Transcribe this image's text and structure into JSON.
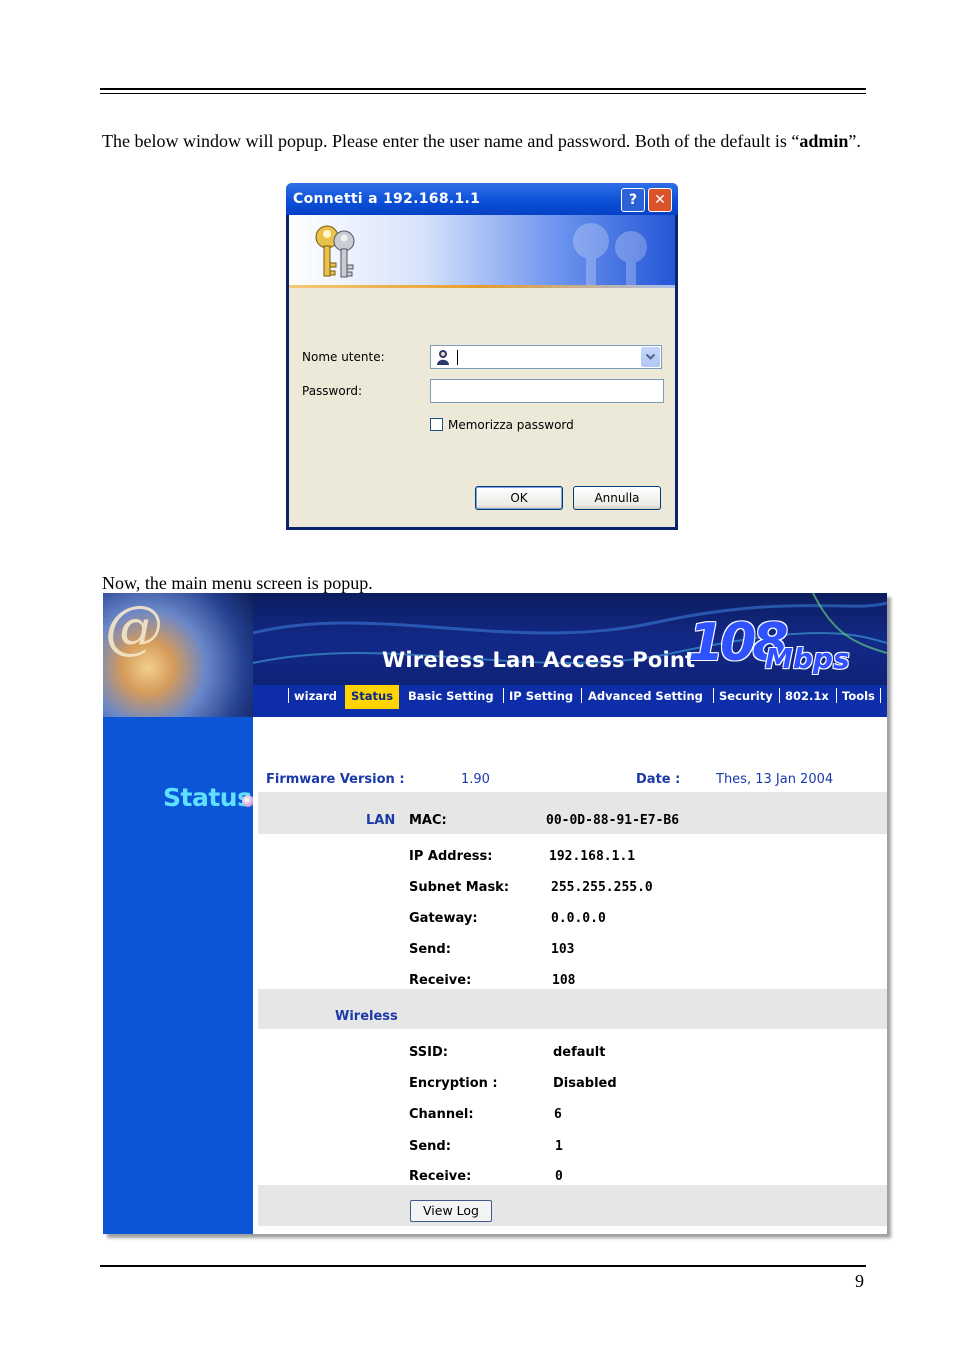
{
  "page": {
    "intro_part1": "The below window will popup.  Please enter the user name and password.  Both of the default is “",
    "intro_bold": "admin",
    "intro_part2": "”.",
    "now_text": "Now, the main menu screen is popup.",
    "page_number": "9"
  },
  "dialog": {
    "title": "Connetti a 192.168.1.1",
    "help_button": "?",
    "close_button": "✕",
    "username_label": "Nome utente:",
    "password_label": "Password:",
    "username_value": "",
    "password_value": "",
    "remember_label": "Memorizza password",
    "remember_checked": false,
    "ok_label": "OK",
    "cancel_label": "Annulla"
  },
  "router": {
    "header_title": "Wireless Lan Access Point",
    "speed_number": "108",
    "speed_unit": "Mbps",
    "nav": {
      "wizard": "wizard",
      "status": "Status",
      "basic": "Basic  Setting",
      "ip": "IP Setting",
      "advanced": "Advanced Setting",
      "security": "Security",
      "dot1x": "802.1x",
      "tools": "Tools"
    },
    "sidebar_title": "Status",
    "firmware_label": "Firmware Version :",
    "firmware_value": "1.90",
    "date_label": "Date :",
    "date_value": "Thes, 13 Jan 2004",
    "lan_section": "LAN",
    "lan": {
      "mac_label": "MAC:",
      "mac_value": "00-0D-88-91-E7-B6",
      "ip_label": "IP Address:",
      "ip_value": "192.168.1.1",
      "mask_label": "Subnet Mask:",
      "mask_value": "255.255.255.0",
      "gateway_label": "Gateway:",
      "gateway_value": "0.0.0.0",
      "send_label": "Send:",
      "send_value": "103",
      "receive_label": "Receive:",
      "receive_value": "108"
    },
    "wireless_section": "Wireless",
    "wireless": {
      "ssid_label": "SSID:",
      "ssid_value": "default",
      "enc_label": "Encryption :",
      "enc_value": "Disabled",
      "channel_label": "Channel:",
      "channel_value": "6",
      "send_label": "Send:",
      "send_value": "1",
      "receive_label": "Receive:",
      "receive_value": "0"
    },
    "viewlog_label": "View Log"
  },
  "colors": {
    "xp_title_blue": "#0a4fd8",
    "router_sidebar": "#0b55d6",
    "nav_active": "#ffd400",
    "label_blue": "#1b3aa8"
  }
}
